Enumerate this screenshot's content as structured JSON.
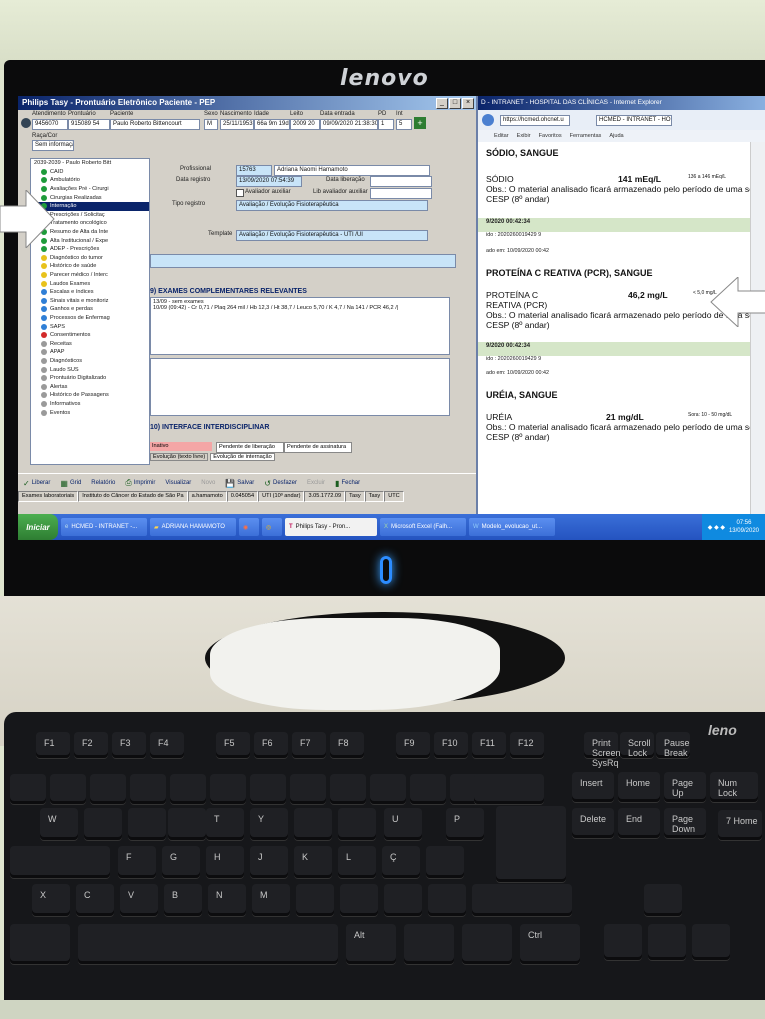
{
  "monitor": {
    "brand": "lenovo"
  },
  "keyboard": {
    "brand": "leno"
  },
  "tasy": {
    "title": "Philips Tasy - Prontuário Eletrônico Paciente - PEP",
    "header_labels": {
      "atendimento": "Atendimento",
      "prontuario": "Prontuário",
      "paciente": "Paciente",
      "sexo": "Sexo",
      "nascimento": "Nascimento",
      "idade": "Idade",
      "leito": "Leito",
      "data_entrada": "Data entrada",
      "pd": "PD",
      "int": "Int"
    },
    "header_values": {
      "atendimento": "9456070",
      "prontuario": "915089 54",
      "paciente": "Paulo Roberto Bittencourt",
      "sexo": "M",
      "nascimento": "25/11/1953",
      "idade": "66a 9m 19d",
      "leito": "2009 20",
      "data_entrada": "09/09/2020 21:38:30",
      "pd": "1",
      "int": "5"
    },
    "raca_label": "Raça/Cor",
    "raca_value": "Sem informação",
    "tree": {
      "root": "2039-2039 - Paulo Roberto Bitt",
      "items": [
        {
          "label": "CAID",
          "color": "#1e9b3a"
        },
        {
          "label": "Ambulatório",
          "color": "#1e9b3a"
        },
        {
          "label": "Avaliações Pré - Cirurgi",
          "color": "#1e9b3a"
        },
        {
          "label": "Cirurgias Realizadas",
          "color": "#1e9b3a"
        },
        {
          "label": "Internação",
          "color": "#1e9b3a"
        },
        {
          "label": "Prescrições / Solicitaç",
          "color": "#1e9b3a"
        },
        {
          "label": "Tratamento oncológico",
          "color": "#1e9b3a"
        },
        {
          "label": "Resumo de Alta da Inte",
          "color": "#1e9b3a"
        },
        {
          "label": "Alta Institucional / Expe",
          "color": "#1e9b3a"
        },
        {
          "label": "ADEP - Prescrições",
          "color": "#1e9b3a"
        },
        {
          "label": "Diagnóstico do tumor",
          "color": "#e8c21c"
        },
        {
          "label": "Histórico de saúde",
          "color": "#e8c21c"
        },
        {
          "label": "Parecer médico / Interc",
          "color": "#e8c21c"
        },
        {
          "label": "Laudos Exames",
          "color": "#e8c21c"
        },
        {
          "label": "Escalas e índices",
          "color": "#2f7fd6"
        },
        {
          "label": "Sinais vitais e monitoriz",
          "color": "#2f7fd6"
        },
        {
          "label": "Ganhos e perdas",
          "color": "#2f7fd6"
        },
        {
          "label": "Processos de Enfermag",
          "color": "#2f7fd6"
        },
        {
          "label": "SAPS",
          "color": "#2f7fd6"
        },
        {
          "label": "Consentimentos",
          "color": "#d22a2a"
        },
        {
          "label": "Receitas",
          "color": "#9a9a9a"
        },
        {
          "label": "APAP",
          "color": "#9a9a9a"
        },
        {
          "label": "Diagnósticos",
          "color": "#9a9a9a"
        },
        {
          "label": "Laudo SUS",
          "color": "#9a9a9a"
        },
        {
          "label": "Prontuário Digitalizado",
          "color": "#9a9a9a"
        },
        {
          "label": "Alertas",
          "color": "#9a9a9a"
        },
        {
          "label": "Histórico de Passagens",
          "color": "#9a9a9a"
        },
        {
          "label": "Informativos",
          "color": "#9a9a9a"
        },
        {
          "label": "Eventos",
          "color": "#9a9a9a"
        }
      ]
    },
    "form": {
      "profissional_label": "Profissional",
      "profissional_code": "15763",
      "profissional_name": "Adriana Naomi Hamamoto",
      "data_registro_label": "Data registro",
      "data_registro_value": "13/09/2020 07:54:39",
      "data_liberacao_label": "Data liberação",
      "avaliador_label": "Avaliador auxiliar",
      "lib_avaliador_label": "Lib avaliador auxiliar",
      "tipo_registro_label": "Tipo registro",
      "tipo_registro_value": "Avaliação / Evolução Fisioterapêutica",
      "template_label": "Template",
      "template_value": "Avaliação / Evolução Fisioterapêutica - UTI /UI"
    },
    "section9_title": "9) EXAMES COMPLEMENTARES RELEVANTES",
    "section9_lines": [
      "13/09 - sem exames",
      "10/09 (09:42) - Cr 0,71 / Plaq 264 mil / Hb 12,3 / Ht 38,7 / Leuco 5,70 / K 4,7 / Na 141 / PCR 46,2 /|"
    ],
    "section10_title": "10) INTERFACE INTERDISCIPLINAR",
    "legend": {
      "inativo": "Inativo",
      "pendente_liberacao": "Pendente de liberação",
      "pendente_assinatura": "Pendente de assinatura"
    },
    "tabs": [
      "Evolução (texto livre)",
      "Evolução de internação"
    ],
    "toolbar": [
      "Liberar",
      "Grid",
      "Relatório",
      "Imprimir",
      "Visualizar",
      "Novo",
      "Salvar",
      "Desfazer",
      "Excluir",
      "Fechar"
    ],
    "status": [
      "Exames laboratoriais",
      "Instituto do Câncer do Estado de São Pa",
      "a.hamamoto",
      "0.045054",
      "UTI (10º andar)",
      "3.05.1772.09",
      "Tasy",
      "Tasy",
      "UTC"
    ]
  },
  "browser": {
    "title": "D - INTRANET - HOSPITAL DAS CLÍNICAS - Internet Explorer",
    "address": "https://hcmed.ohcnet.u",
    "tab": "HCMED - INTRANET - HO...",
    "menu": [
      "Editar",
      "Exibir",
      "Favoritos",
      "Ferramentas",
      "Ajuda"
    ],
    "blocks": [
      {
        "heading": "SÓDIO, SANGUE",
        "lines": [
          "SÓDIO",
          "Obs.: O material analisado ficará armazenado pelo período de uma sema",
          "CESP (8º andar)"
        ],
        "value": "141 mEq/L",
        "ref": "136 a 146 mEq/L",
        "date": "9/2020 00:42:34",
        "code": "ido : 2020260019429 9",
        "released": "ado em: 10/09/2020 00:42"
      },
      {
        "heading": "PROTEÍNA C REATIVA (PCR), SANGUE",
        "lines": [
          "PROTEÍNA C",
          "REATIVA (PCR)",
          "Obs.: O material analisado ficará armazenado pelo período de uma sema",
          "CESP (8º andar)"
        ],
        "value": "46,2 mg/L",
        "ref": "< 5,0 mg/L",
        "date": "9/2020 00:42:34",
        "code": "ido : 2020260019429 9",
        "released": "ado em: 10/09/2020 00:42"
      },
      {
        "heading": "URÉIA, SANGUE",
        "lines": [
          "URÉIA",
          "Obs.: O material analisado ficará armazenado pelo período de uma sema",
          "CESP (8º andar)"
        ],
        "value": "21 mg/dL",
        "ref": "Sora: 10 - 50 mg/dL"
      }
    ]
  },
  "taskbar": {
    "start": "Iniciar",
    "items": [
      "HCMED - INTRANET -...",
      "ADRIANA HAMAMOTO",
      "Philips Tasy - Pron...",
      "Microsoft Excel (Falh...",
      "Modelo_evolucao_ut..."
    ],
    "time": "07:56",
    "date": "13/09/2020"
  },
  "keys": {
    "row1": [
      "F1",
      "F2",
      "F3",
      "F4",
      "F5",
      "F6",
      "F7",
      "F8",
      "F9",
      "F10",
      "F11",
      "F12",
      "Print Screen SysRq",
      "Scroll Lock",
      "Pause Break"
    ],
    "nav": [
      "Insert",
      "Home",
      "Page Up",
      "Delete",
      "End",
      "Page Down"
    ],
    "letters_row": [
      "W",
      "T",
      "Y",
      "U",
      "P"
    ],
    "home_row": [
      "F",
      "G",
      "H",
      "J",
      "K",
      "L",
      "Ç"
    ],
    "bottom_row": [
      "X",
      "C",
      "V",
      "B",
      "N",
      "M"
    ],
    "alt": "Alt",
    "ctrl": "Ctrl",
    "numlock": "Num Lock",
    "seven_home": "7 Home"
  },
  "colors": {
    "tasy_title": "#0a246a",
    "band": "#d5e6c8",
    "power_led": "#2c8cff"
  }
}
